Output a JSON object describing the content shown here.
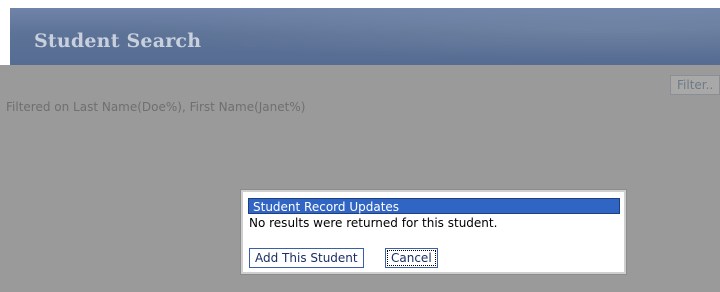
{
  "header": {
    "title": "Student Search"
  },
  "toolbar": {
    "filter_label": "Filter.."
  },
  "filter_summary": "Filtered on Last Name(Doe%), First Name(Janet%)",
  "dialog": {
    "title": "Student Record Updates",
    "message": "No results were returned for this student.",
    "add_label": "Add This Student",
    "cancel_label": "Cancel"
  },
  "colors": {
    "header": "#5c7296",
    "dialog_title_bg": "#3165c4",
    "overlay": "#9a9a9a"
  }
}
